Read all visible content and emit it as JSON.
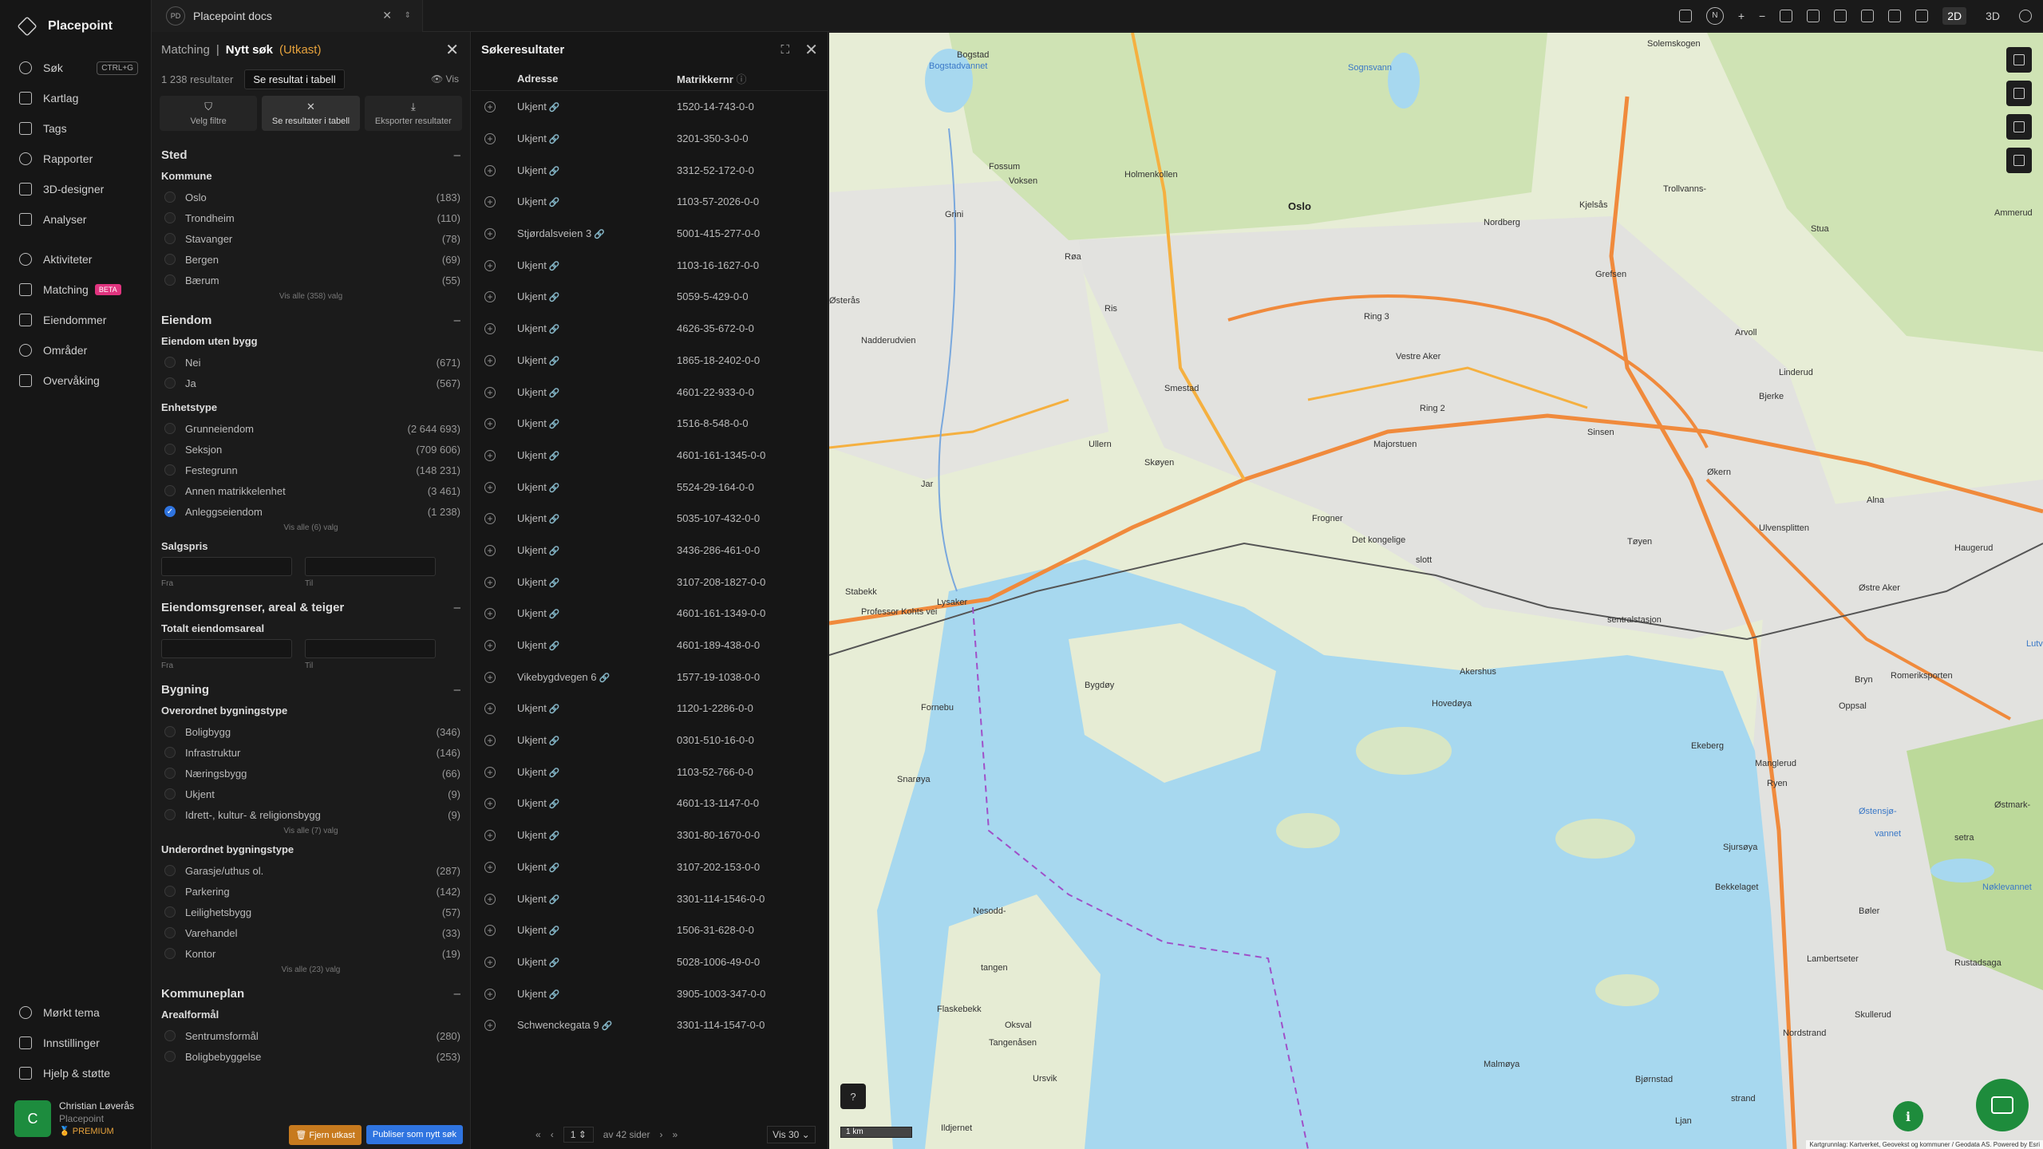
{
  "app": {
    "name": "Placepoint"
  },
  "nav": {
    "items": [
      {
        "label": "Søk",
        "icon": "search-icon",
        "kbd": "CTRL+G"
      },
      {
        "label": "Kartlag",
        "icon": "layers-icon"
      },
      {
        "label": "Tags",
        "icon": "bookmark-icon"
      },
      {
        "label": "Rapporter",
        "icon": "chart-icon"
      },
      {
        "label": "3D-designer",
        "icon": "cube-icon"
      },
      {
        "label": "Analyser",
        "icon": "bolt-icon"
      }
    ],
    "items2": [
      {
        "label": "Aktiviteter",
        "icon": "activity-icon"
      },
      {
        "label": "Matching",
        "icon": "matching-icon",
        "badge": "BETA"
      },
      {
        "label": "Eiendommer",
        "icon": "document-icon"
      },
      {
        "label": "Områder",
        "icon": "area-icon"
      },
      {
        "label": "Overvåking",
        "icon": "monitor-icon"
      }
    ],
    "bottom": [
      {
        "label": "Mørkt tema",
        "icon": "moon-icon"
      },
      {
        "label": "Innstillinger",
        "icon": "gear-icon"
      },
      {
        "label": "Hjelp & støtte",
        "icon": "help-icon"
      }
    ],
    "user": {
      "initial": "C",
      "name": "Christian Løverås",
      "org": "Placepoint",
      "plan": "PREMIUM"
    }
  },
  "tab": {
    "badge": "PD",
    "title": "Placepoint docs"
  },
  "filter": {
    "breadcrumb": "Matching",
    "title": "Nytt søk",
    "status": "(Utkast)",
    "count": "1 238 resultater",
    "table_pill": "Se resultat i tabell",
    "vis": "Vis",
    "buttons": [
      "Velg filtre",
      "Se resultater i tabell",
      "Eksporter resultater"
    ],
    "sections": {
      "sted": {
        "title": "Sted",
        "kommune": "Kommune",
        "options": [
          [
            "Oslo",
            "(183)"
          ],
          [
            "Trondheim",
            "(110)"
          ],
          [
            "Stavanger",
            "(78)"
          ],
          [
            "Bergen",
            "(69)"
          ],
          [
            "Bærum",
            "(55)"
          ]
        ],
        "showall": "Vis alle (358) valg"
      },
      "eiendom": {
        "title": "Eiendom",
        "uten_bygg": "Eiendom uten bygg",
        "uten_options": [
          [
            "Nei",
            "(671)"
          ],
          [
            "Ja",
            "(567)"
          ]
        ],
        "enhetstype": "Enhetstype",
        "enhet_options": [
          [
            "Grunneiendom",
            "(2 644 693)"
          ],
          [
            "Seksjon",
            "(709 606)"
          ],
          [
            "Festegrunn",
            "(148 231)"
          ],
          [
            "Annen matrikkelenhet",
            "(3 461)"
          ],
          [
            "Anleggseiendom",
            "(1 238)"
          ]
        ],
        "enhet_showall": "Vis alle (6) valg",
        "salgspris": "Salgspris",
        "fra": "Fra",
        "til": "Til"
      },
      "grenser": {
        "title": "Eiendomsgrenser, areal & teiger",
        "areal": "Totalt eiendomsareal",
        "fra": "Fra",
        "til": "Til"
      },
      "bygning": {
        "title": "Bygning",
        "overordnet": "Overordnet bygningstype",
        "over_options": [
          [
            "Boligbygg",
            "(346)"
          ],
          [
            "Infrastruktur",
            "(146)"
          ],
          [
            "Næringsbygg",
            "(66)"
          ],
          [
            "Ukjent",
            "(9)"
          ],
          [
            "Idrett-, kultur- & religionsbygg",
            "(9)"
          ]
        ],
        "over_showall": "Vis alle (7) valg",
        "underordnet": "Underordnet bygningstype",
        "under_options": [
          [
            "Garasje/uthus ol.",
            "(287)"
          ],
          [
            "Parkering",
            "(142)"
          ],
          [
            "Leilighetsbygg",
            "(57)"
          ],
          [
            "Varehandel",
            "(33)"
          ],
          [
            "Kontor",
            "(19)"
          ]
        ],
        "under_showall": "Vis alle (23) valg"
      },
      "kommuneplan": {
        "title": "Kommuneplan",
        "arealformal": "Arealformål",
        "options": [
          [
            "Sentrumsformål",
            "(280)"
          ],
          [
            "Boligbebyggelse",
            "(253)"
          ]
        ]
      }
    },
    "footer": {
      "remove": "Fjern utkast",
      "publish": "Publiser som nytt søk"
    }
  },
  "results": {
    "title": "Søkeresultater",
    "col_address": "Adresse",
    "col_matrikkel": "Matrikkernr",
    "rows": [
      [
        "Ukjent",
        "1520-14-743-0-0"
      ],
      [
        "Ukjent",
        "3201-350-3-0-0"
      ],
      [
        "Ukjent",
        "3312-52-172-0-0"
      ],
      [
        "Ukjent",
        "1103-57-2026-0-0"
      ],
      [
        "Stjørdalsveien 3",
        "5001-415-277-0-0"
      ],
      [
        "Ukjent",
        "1103-16-1627-0-0"
      ],
      [
        "Ukjent",
        "5059-5-429-0-0"
      ],
      [
        "Ukjent",
        "4626-35-672-0-0"
      ],
      [
        "Ukjent",
        "1865-18-2402-0-0"
      ],
      [
        "Ukjent",
        "4601-22-933-0-0"
      ],
      [
        "Ukjent",
        "1516-8-548-0-0"
      ],
      [
        "Ukjent",
        "4601-161-1345-0-0"
      ],
      [
        "Ukjent",
        "5524-29-164-0-0"
      ],
      [
        "Ukjent",
        "5035-107-432-0-0"
      ],
      [
        "Ukjent",
        "3436-286-461-0-0"
      ],
      [
        "Ukjent",
        "3107-208-1827-0-0"
      ],
      [
        "Ukjent",
        "4601-161-1349-0-0"
      ],
      [
        "Ukjent",
        "4601-189-438-0-0"
      ],
      [
        "Vikebygdvegen 6",
        "1577-19-1038-0-0"
      ],
      [
        "Ukjent",
        "1120-1-2286-0-0"
      ],
      [
        "Ukjent",
        "0301-510-16-0-0"
      ],
      [
        "Ukjent",
        "1103-52-766-0-0"
      ],
      [
        "Ukjent",
        "4601-13-1147-0-0"
      ],
      [
        "Ukjent",
        "3301-80-1670-0-0"
      ],
      [
        "Ukjent",
        "3107-202-153-0-0"
      ],
      [
        "Ukjent",
        "3301-114-1546-0-0"
      ],
      [
        "Ukjent",
        "1506-31-628-0-0"
      ],
      [
        "Ukjent",
        "5028-1006-49-0-0"
      ],
      [
        "Ukjent",
        "3905-1003-347-0-0"
      ],
      [
        "Schwenckegata 9",
        "3301-114-1547-0-0"
      ]
    ],
    "pager": {
      "page": "1",
      "of": "av 42 sider",
      "per_page": "Vis 30"
    }
  },
  "toolbar": {
    "north": "N",
    "plus": "+",
    "minus": "−",
    "mode2d": "2D",
    "mode3d": "3D"
  },
  "map": {
    "labels": [
      {
        "t": "Oslo",
        "big": true
      },
      {
        "t": "Bogstad"
      },
      {
        "t": "Bogstadvannet",
        "water": true
      },
      {
        "t": "Sognsvann",
        "water": true
      },
      {
        "t": "Solemskogen"
      },
      {
        "t": "Holmenkollen"
      },
      {
        "t": "Voksen"
      },
      {
        "t": "Fossum"
      },
      {
        "t": "Grini"
      },
      {
        "t": "Røa"
      },
      {
        "t": "Nordberg"
      },
      {
        "t": "Kjelsås"
      },
      {
        "t": "Grefsen"
      },
      {
        "t": "Trollvanns-"
      },
      {
        "t": "Ris"
      },
      {
        "t": "Ring 3"
      },
      {
        "t": "Vestre Aker"
      },
      {
        "t": "Arvoll"
      },
      {
        "t": "Linderud"
      },
      {
        "t": "Bjerke"
      },
      {
        "t": "Ring 2"
      },
      {
        "t": "Smestad"
      },
      {
        "t": "Ullern"
      },
      {
        "t": "Skøyen"
      },
      {
        "t": "Majorstuen"
      },
      {
        "t": "Sinsen"
      },
      {
        "t": "Økern"
      },
      {
        "t": "Alna"
      },
      {
        "t": "Frogner"
      },
      {
        "t": "Det kongelige"
      },
      {
        "t": "slott"
      },
      {
        "t": "Tøyen"
      },
      {
        "t": "Ulvensplitten"
      },
      {
        "t": "Haugerud"
      },
      {
        "t": "Østre Aker"
      },
      {
        "t": "sentralstasjon"
      },
      {
        "t": "Akershus"
      },
      {
        "t": "Bryn"
      },
      {
        "t": "Stabekk"
      },
      {
        "t": "Lysaker"
      },
      {
        "t": "Professor Kohts vei"
      },
      {
        "t": "Bygdøy"
      },
      {
        "t": "Fornebu"
      },
      {
        "t": "Snarøya"
      },
      {
        "t": "Hovedøya"
      },
      {
        "t": "Ekeberg"
      },
      {
        "t": "Oppsal"
      },
      {
        "t": "Romeriksporten"
      },
      {
        "t": "Manglerud"
      },
      {
        "t": "Ryen"
      },
      {
        "t": "Østensjø-",
        "water": true
      },
      {
        "t": "vannet",
        "water": true
      },
      {
        "t": "Østmark-"
      },
      {
        "t": "Nøklevannet",
        "water": true
      },
      {
        "t": "Sjursøya"
      },
      {
        "t": "Bekkelaget"
      },
      {
        "t": "Bøler"
      },
      {
        "t": "Lambertseter"
      },
      {
        "t": "Rustadsaga"
      },
      {
        "t": "Skullerud"
      },
      {
        "t": "Nesodd-"
      },
      {
        "t": "tangen"
      },
      {
        "t": "Flaskebekk"
      },
      {
        "t": "Oksval"
      },
      {
        "t": "Tangenåsen"
      },
      {
        "t": "Ursvik"
      },
      {
        "t": "Malmøya"
      },
      {
        "t": "Bjørnstad"
      },
      {
        "t": "Ildjernet"
      },
      {
        "t": "Ljan"
      },
      {
        "t": "strand"
      },
      {
        "t": "Nordstrand"
      },
      {
        "t": "Østerås"
      },
      {
        "t": "Jar"
      },
      {
        "t": "Nadderudvien"
      },
      {
        "t": "Ammerud"
      },
      {
        "t": "Stua"
      },
      {
        "t": "setra"
      },
      {
        "t": "Lutvannet",
        "water": true
      }
    ],
    "scale": "1 km",
    "help": "?",
    "info": "i",
    "attribution": "Kartgrunnlag: Kartverket, Geovekst og kommuner / Geodata AS. Powered by Esri"
  }
}
